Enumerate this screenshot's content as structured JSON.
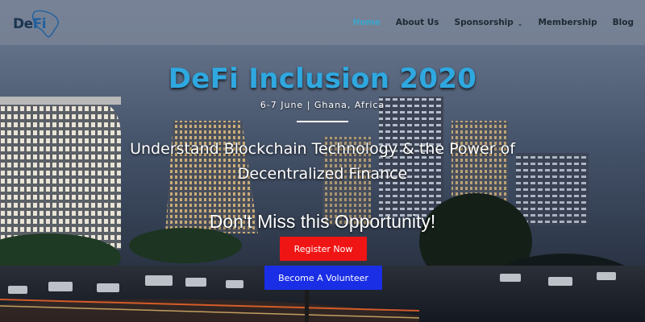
{
  "logo": {
    "text_de": "De",
    "text_fi": "Fi"
  },
  "nav": {
    "items": [
      {
        "label": "Home",
        "active": true
      },
      {
        "label": "About Us",
        "active": false
      },
      {
        "label": "Sponsorship",
        "active": false,
        "dropdown": true
      },
      {
        "label": "Membership",
        "active": false
      },
      {
        "label": "Blog",
        "active": false
      }
    ],
    "active_color": "#3aa6ce"
  },
  "hero": {
    "title": "DeFi Inclusion 2020",
    "date": "6-7 June | Ghana, Africa",
    "tagline_line1": "Understand Blockchain Technology & the Power of",
    "tagline_line2": "Decentralized Finance",
    "cta_heading": "Don't Miss this Opportunity!",
    "title_color": "#2fa8e0"
  },
  "buttons": {
    "register": "Register Now",
    "volunteer": "Become A Volunteer",
    "register_color": "#f01515",
    "volunteer_color": "#1a2ee6"
  }
}
